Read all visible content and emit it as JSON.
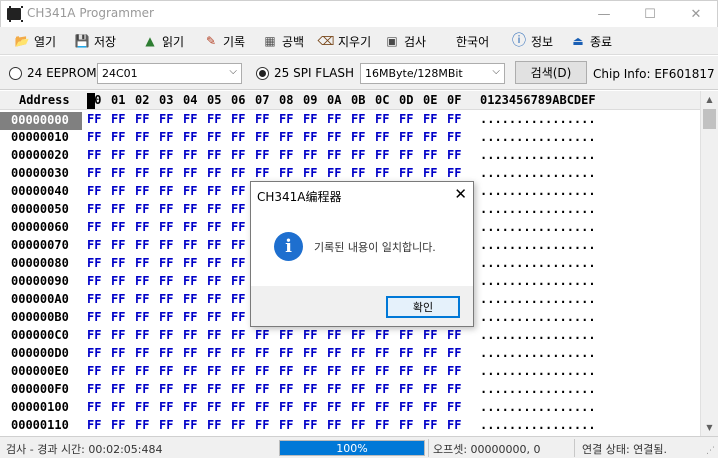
{
  "window": {
    "title": "CH341A Programmer",
    "minimize": "—",
    "maximize": "☐",
    "close": "✕"
  },
  "toolbar": [
    {
      "label": "열기",
      "icon": "folder-open-icon",
      "glyph": "📂"
    },
    {
      "label": "저장",
      "icon": "save-icon",
      "glyph": "💾"
    },
    {
      "label": "읽기",
      "icon": "read-chip-icon",
      "glyph": "▲"
    },
    {
      "label": "기록",
      "icon": "write-chip-icon",
      "glyph": "✎"
    },
    {
      "label": "공백",
      "icon": "blank-check-icon",
      "glyph": "▦"
    },
    {
      "label": "지우기",
      "icon": "erase-icon",
      "glyph": "⌫"
    },
    {
      "label": "검사",
      "icon": "verify-icon",
      "glyph": "▣"
    },
    {
      "label": "한국어",
      "icon": "",
      "glyph": ""
    },
    {
      "label": "정보",
      "icon": "info-icon",
      "glyph": "ⓘ"
    },
    {
      "label": "종료",
      "icon": "exit-icon",
      "glyph": "⏏"
    }
  ],
  "chip": {
    "eeprom_label": "24 EEPROM",
    "eeprom_value": "24C01",
    "spi_label": "25 SPI FLASH",
    "spi_value": "16MByte/128MBit",
    "spi_selected": true,
    "search_label": "검색(D)",
    "chip_info": "Chip Info: EF601817"
  },
  "hex": {
    "address_header": "Address",
    "columns": [
      "00",
      "01",
      "02",
      "03",
      "04",
      "05",
      "06",
      "07",
      "08",
      "09",
      "0A",
      "0B",
      "0C",
      "0D",
      "0E",
      "0F"
    ],
    "ascii_header": "0123456789ABCDEF",
    "rows": [
      "00000000",
      "00000010",
      "00000020",
      "00000030",
      "00000040",
      "00000050",
      "00000060",
      "00000070",
      "00000080",
      "00000090",
      "000000A0",
      "000000B0",
      "000000C0",
      "000000D0",
      "000000E0",
      "000000F0",
      "00000100",
      "00000110"
    ],
    "byte_value": "FF",
    "ascii_value": "................",
    "selected_row": "00000000"
  },
  "status": {
    "elapsed": "검사 - 경과 시간: 00:02:05:484",
    "progress_text": "100%",
    "progress": 1.0,
    "offset": "오프셋: 00000000, 0",
    "connection": "연결 상태: 연결됨."
  },
  "dialog": {
    "title": "CH341A编程器",
    "close": "✕",
    "icon": "info-icon",
    "message": "기록된 내용이 일치합니다.",
    "ok_label": "확인"
  },
  "colors": {
    "byte_blue": "#0000c8",
    "accent": "#0078d7",
    "selected_addr_bg": "#808080"
  }
}
